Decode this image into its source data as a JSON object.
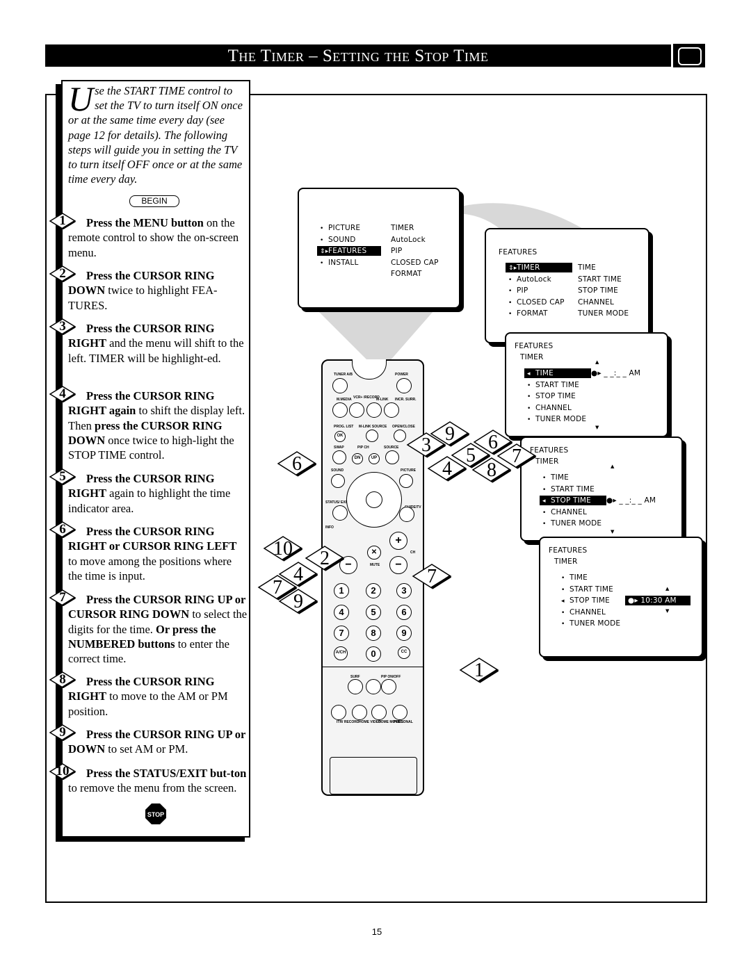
{
  "header": {
    "title": "The Timer – Setting the Stop Time",
    "icon": "tv-icon"
  },
  "intro": {
    "drop_cap": "U",
    "text": "se the START TIME control to set the TV to turn itself ON once or at the same time every day (see page 12  for details). The following steps will guide you in setting the TV to turn itself OFF once or at the same time every day."
  },
  "begin_label": "BEGIN",
  "steps": [
    {
      "num": "1",
      "parts": [
        {
          "b": true,
          "t": "Press the MENU button"
        },
        {
          "b": false,
          "t": " on the remote control to show the on-screen menu."
        }
      ]
    },
    {
      "num": "2",
      "parts": [
        {
          "b": true,
          "t": "Press the CURSOR RING DOWN"
        },
        {
          "b": false,
          "t": " twice to highlight FEA-TURES."
        }
      ]
    },
    {
      "num": "3",
      "parts": [
        {
          "b": true,
          "t": "Press the CURSOR RING RIGHT"
        },
        {
          "b": false,
          "t": " and the menu will shift to the left. TIMER will be highlight-ed."
        }
      ]
    },
    {
      "num": "4",
      "parts": [
        {
          "b": true,
          "t": "Press the CURSOR RING RIGHT again"
        },
        {
          "b": false,
          "t": " to shift the display left. Then "
        },
        {
          "b": true,
          "t": "press the CURSOR RING DOWN"
        },
        {
          "b": false,
          "t": " once twice to high-light the STOP TIME control."
        }
      ]
    },
    {
      "num": "5",
      "parts": [
        {
          "b": true,
          "t": "Press the CURSOR RING RIGHT"
        },
        {
          "b": false,
          "t": " again to highlight the time indicator area."
        }
      ]
    },
    {
      "num": "6",
      "parts": [
        {
          "b": true,
          "t": "Press the CURSOR RING RIGHT or CURSOR RING LEFT"
        },
        {
          "b": false,
          "t": " to move among the positions where the time is input."
        }
      ]
    },
    {
      "num": "7",
      "parts": [
        {
          "b": true,
          "t": "Press the CURSOR RING UP or CURSOR RING DOWN"
        },
        {
          "b": false,
          "t": " to select the digits for the time. "
        },
        {
          "b": true,
          "t": "Or press the NUMBERED buttons"
        },
        {
          "b": false,
          "t": " to enter the correct time."
        }
      ]
    },
    {
      "num": "8",
      "parts": [
        {
          "b": true,
          "t": "Press the CURSOR RING RIGHT"
        },
        {
          "b": false,
          "t": " to move to the AM or PM position."
        }
      ]
    },
    {
      "num": "9",
      "parts": [
        {
          "b": true,
          "t": "Press the CURSOR RING UP or DOWN"
        },
        {
          "b": false,
          "t": " to set AM or PM."
        }
      ]
    },
    {
      "num": "10",
      "parts": [
        {
          "b": true,
          "t": "Press the STATUS/EXIT but-ton"
        },
        {
          "b": false,
          "t": " to remove the menu from the screen."
        }
      ]
    }
  ],
  "stop_sign": "STOP",
  "menus": [
    {
      "titles": [],
      "rows": [
        {
          "label": "PICTURE",
          "mark": "•",
          "hl": false,
          "right": "TIMER"
        },
        {
          "label": "SOUND",
          "mark": "•",
          "hl": false,
          "right": "AutoLock"
        },
        {
          "label": "FEATURES",
          "mark": "⇕▸",
          "hl": true,
          "right": "PIP"
        },
        {
          "label": "INSTALL",
          "mark": "•",
          "hl": false,
          "right": "CLOSED  CAP"
        },
        {
          "label": "",
          "mark": "",
          "hl": false,
          "right": "FORMAT"
        }
      ]
    },
    {
      "titles": [
        "FEATURES"
      ],
      "rows": [
        {
          "label": "TIMER",
          "mark": "⇕▸",
          "hl": true,
          "right": "TIME"
        },
        {
          "label": "AutoLock",
          "mark": "•",
          "hl": false,
          "right": "START  TIME"
        },
        {
          "label": "PIP",
          "mark": "•",
          "hl": false,
          "right": "STOP  TIME"
        },
        {
          "label": "CLOSED  CAP",
          "mark": "•",
          "hl": false,
          "right": "CHANNEL"
        },
        {
          "label": "FORMAT",
          "mark": "•",
          "hl": false,
          "right": "TUNER  MODE"
        }
      ]
    },
    {
      "titles": [
        "FEATURES",
        "TIMER"
      ],
      "rows": [
        {
          "label": "TIME",
          "mark": "◂",
          "hl": true,
          "right": "●▸  _ _:_ _  AM",
          "right_hl": false
        },
        {
          "label": "START  TIME",
          "mark": "•",
          "hl": false,
          "right": ""
        },
        {
          "label": "STOP  TIME",
          "mark": "•",
          "hl": false,
          "right": ""
        },
        {
          "label": "CHANNEL",
          "mark": "•",
          "hl": false,
          "right": ""
        },
        {
          "label": "TUNER  MODE",
          "mark": "•",
          "hl": false,
          "right": ""
        }
      ]
    },
    {
      "titles": [
        "FEATURES",
        "TIMER"
      ],
      "rows": [
        {
          "label": "TIME",
          "mark": "•",
          "hl": false,
          "right": ""
        },
        {
          "label": "START  TIME",
          "mark": "•",
          "hl": false,
          "right": ""
        },
        {
          "label": "STOP  TIME",
          "mark": "◂",
          "hl": true,
          "right": "●▸  _ _:_ _  AM",
          "right_hl": false
        },
        {
          "label": "CHANNEL",
          "mark": "•",
          "hl": false,
          "right": ""
        },
        {
          "label": "TUNER  MODE",
          "mark": "•",
          "hl": false,
          "right": ""
        }
      ]
    },
    {
      "titles": [
        "FEATURES",
        "TIMER"
      ],
      "rows": [
        {
          "label": "TIME",
          "mark": "•",
          "hl": false,
          "right": ""
        },
        {
          "label": "START  TIME",
          "mark": "•",
          "hl": false,
          "right": ""
        },
        {
          "label": "STOP  TIME",
          "mark": "◂",
          "hl": false,
          "right": "●▸  10:30 AM",
          "right_hl": true
        },
        {
          "label": "CHANNEL",
          "mark": "•",
          "hl": false,
          "right": ""
        },
        {
          "label": "TUNER  MODE",
          "mark": "•",
          "hl": false,
          "right": ""
        }
      ]
    }
  ],
  "remote": {
    "labels": [
      "TUNER A/B",
      "POWER",
      "M.MEDIA",
      "VCR+ /RECORD",
      "M-LINK",
      "INCR. SURR.",
      "PROG. LIST",
      "M-LINK SOURCE",
      "OPEN/CLOSE",
      "SWAP",
      "PIP CH",
      "SOURCE",
      "SOUND",
      "PICTURE",
      "STATUS/ EXIT",
      "GUIDE/TV",
      "INFO",
      "MUTE",
      "CH",
      "SURF",
      "PIP ON/OFF",
      "ITR/ RECORD",
      "HOME VIDEO",
      "HOME MOVIES",
      "PERSONAL"
    ],
    "buttons": [
      "OK",
      "DN",
      "UP",
      "+",
      "−",
      "−",
      "1",
      "2",
      "3",
      "4",
      "5",
      "6",
      "7",
      "8",
      "9",
      "A/CH",
      "0",
      "CC"
    ]
  },
  "callouts": [
    "6",
    "10",
    "4",
    "2",
    "7",
    "9",
    "7",
    "9",
    "3",
    "4",
    "5",
    "6",
    "8",
    "7",
    "1"
  ],
  "page_number": "15"
}
